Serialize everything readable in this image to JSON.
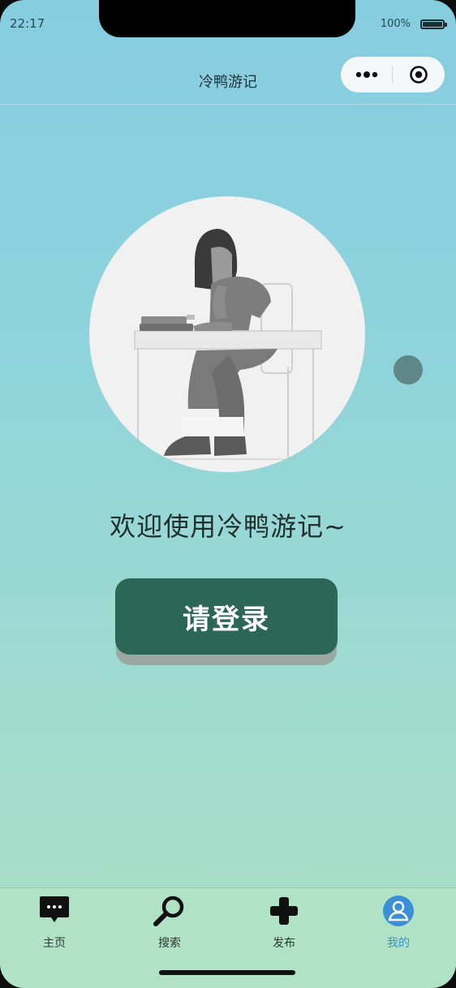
{
  "status_bar": {
    "time": "22:17",
    "battery": "100%"
  },
  "navbar": {
    "title": "冷鸭游记"
  },
  "main": {
    "welcome_text": "欢迎使用冷鸭游记~",
    "login_button": "请登录"
  },
  "tabbar": {
    "items": [
      {
        "label": "主页",
        "icon": "message-icon",
        "active": false
      },
      {
        "label": "搜索",
        "icon": "search-icon",
        "active": false
      },
      {
        "label": "发布",
        "icon": "plus-icon",
        "active": false
      },
      {
        "label": "我的",
        "icon": "user-icon",
        "active": true
      }
    ]
  },
  "colors": {
    "primary_button": "#2c6756",
    "active_tab": "#3b8fd6",
    "gradient_top": "#86cde0",
    "gradient_bottom": "#acdfc6"
  }
}
